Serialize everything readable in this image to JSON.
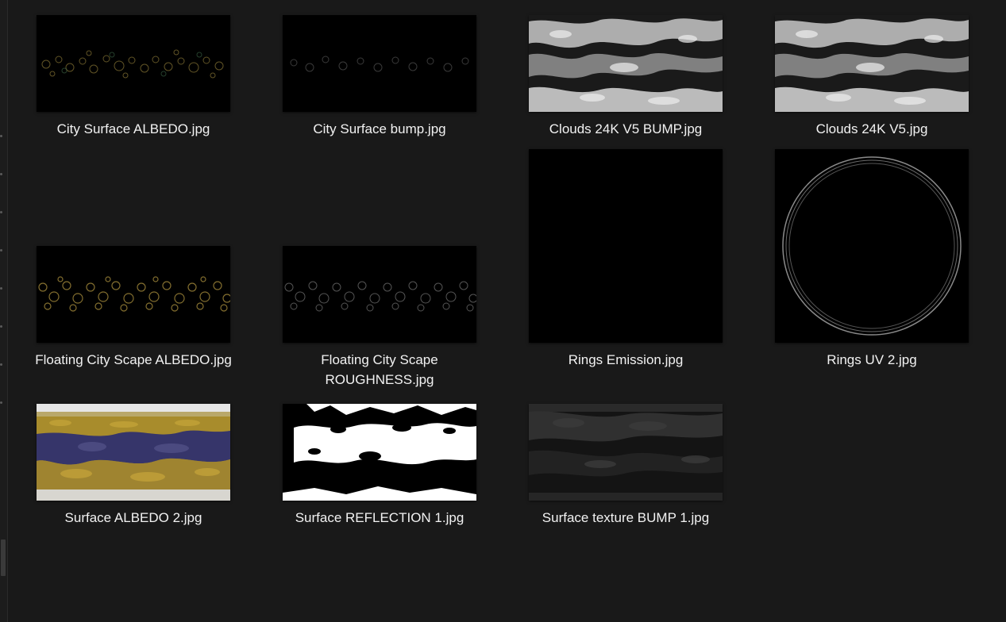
{
  "files": [
    {
      "name": "City Surface ALBEDO.jpg",
      "thumbnail": "city-albedo"
    },
    {
      "name": "City Surface bump.jpg",
      "thumbnail": "city-bump"
    },
    {
      "name": "Clouds 24K V5 BUMP.jpg",
      "thumbnail": "clouds"
    },
    {
      "name": "Clouds 24K V5.jpg",
      "thumbnail": "clouds"
    },
    {
      "name": "Floating City Scape ALBEDO.jpg",
      "thumbnail": "floating-albedo"
    },
    {
      "name_lines": [
        "Floating City Scape",
        "ROUGHNESS.jpg"
      ],
      "thumbnail": "floating-roughness"
    },
    {
      "name": "Rings Emission.jpg",
      "thumbnail": "black-square"
    },
    {
      "name": "Rings UV 2.jpg",
      "thumbnail": "rings"
    },
    {
      "name": "Surface ALBEDO 2.jpg",
      "thumbnail": "surface-albedo"
    },
    {
      "name": "Surface REFLECTION 1.jpg",
      "thumbnail": "surface-reflection"
    },
    {
      "name": "Surface texture BUMP 1.jpg",
      "thumbnail": "surface-bump"
    }
  ],
  "colors": {
    "background": "#191919",
    "label": "#f2f2f2",
    "albedo_gold": "#b8962e",
    "albedo_blue": "#3d3a72"
  }
}
